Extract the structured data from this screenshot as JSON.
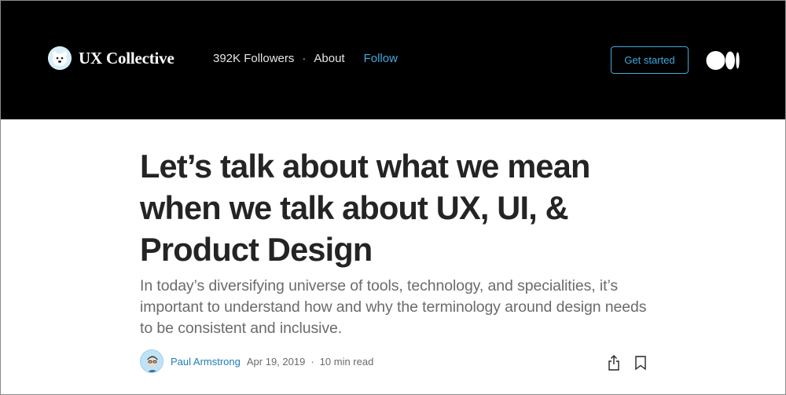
{
  "header": {
    "brand_name": "UX Collective",
    "followers": "392K Followers",
    "separator": "·",
    "about_label": "About",
    "follow_label": "Follow",
    "get_started_label": "Get started",
    "accent_color": "#3fa9dc",
    "background_color": "#000000"
  },
  "article": {
    "title": "Let’s talk about what we mean when we talk about UX, UI, & Product Design",
    "subtitle": "In today’s diversifying universe of tools, technology, and specialities, it’s important to understand how and why the terminology around design needs to be consistent and inclusive."
  },
  "byline": {
    "author": "Paul Armstrong",
    "date": "Apr 19, 2019",
    "separator": "·",
    "read_time": "10 min read"
  },
  "icons": {
    "brand": "polar-bear-logo-icon",
    "medium": "medium-logo-icon",
    "share": "share-icon",
    "bookmark": "bookmark-icon",
    "avatar": "author-avatar"
  }
}
